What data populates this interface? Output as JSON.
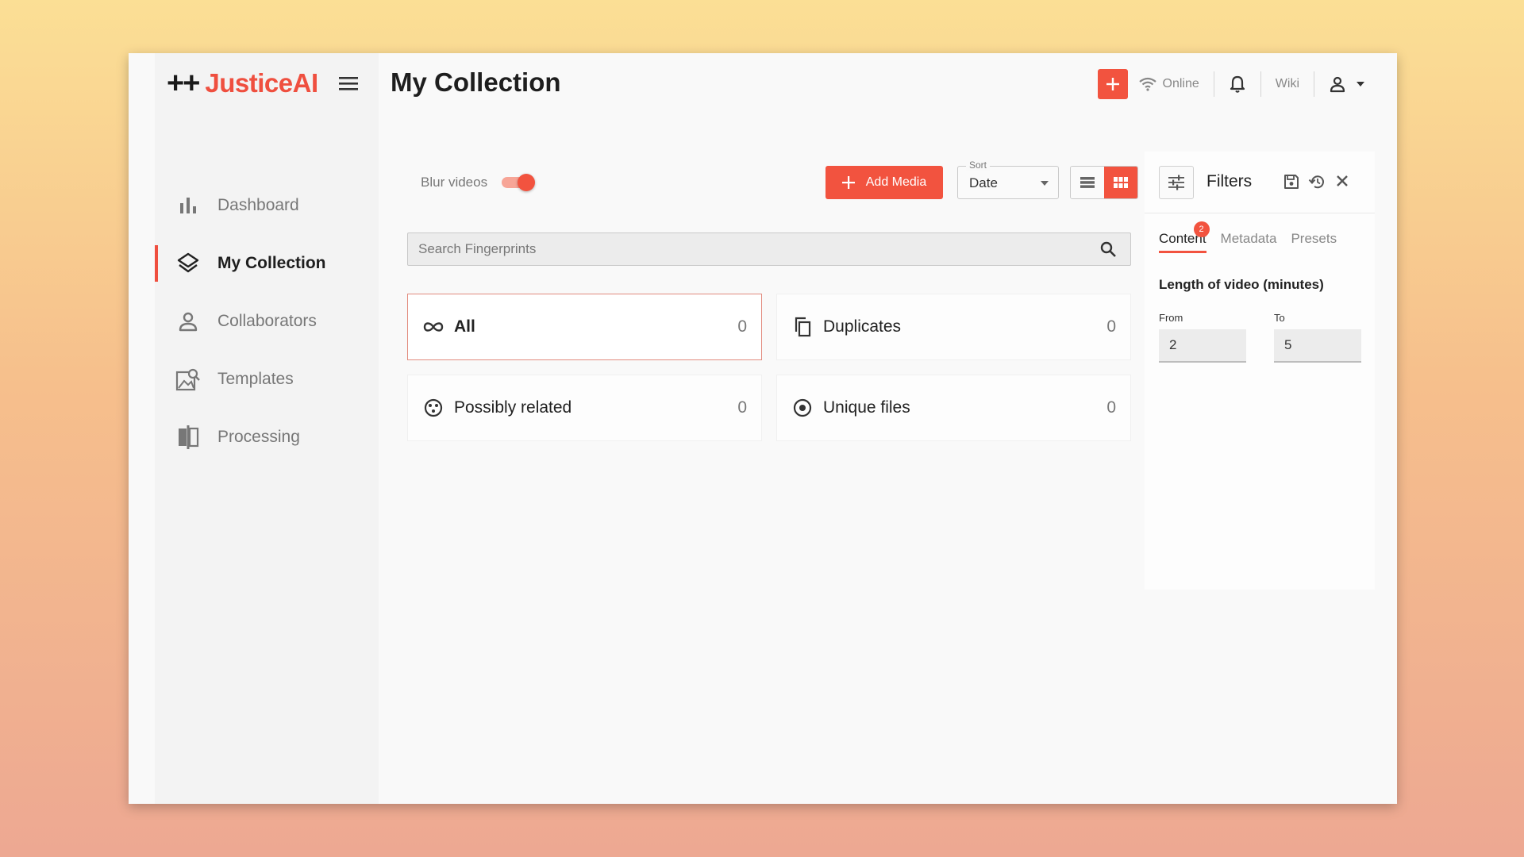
{
  "app": {
    "logo_plus": "++",
    "logo_name": "JusticeAI",
    "title": "My Collection"
  },
  "sidebar": {
    "items": [
      {
        "label": "Dashboard",
        "icon": "bar-chart-icon"
      },
      {
        "label": "My Collection",
        "icon": "layers-icon",
        "active": true
      },
      {
        "label": "Collaborators",
        "icon": "person-icon"
      },
      {
        "label": "Templates",
        "icon": "image-template-icon"
      },
      {
        "label": "Processing",
        "icon": "compare-icon"
      }
    ]
  },
  "topbar": {
    "status": "Online",
    "wiki": "Wiki"
  },
  "toolbar": {
    "blur_label": "Blur videos",
    "blur_on": true,
    "add_media": "Add Media",
    "sort_label": "Sort",
    "sort_value": "Date",
    "view_mode": "grid"
  },
  "search": {
    "placeholder": "Search Fingerprints"
  },
  "categories": [
    {
      "label": "All",
      "count": "0",
      "icon": "infinity-icon",
      "selected": true
    },
    {
      "label": "Duplicates",
      "count": "0",
      "icon": "copy-icon"
    },
    {
      "label": "Possibly related",
      "count": "0",
      "icon": "related-icon"
    },
    {
      "label": "Unique files",
      "count": "0",
      "icon": "radio-icon"
    }
  ],
  "filters": {
    "title": "Filters",
    "tabs": [
      {
        "label": "Content",
        "badge": "2",
        "active": true
      },
      {
        "label": "Metadata"
      },
      {
        "label": "Presets"
      }
    ],
    "section_title": "Length of video (minutes)",
    "from_label": "From",
    "to_label": "To",
    "from_value": "2",
    "to_value": "5"
  },
  "colors": {
    "accent": "#f2533f",
    "brand": "#ef4f3f"
  }
}
